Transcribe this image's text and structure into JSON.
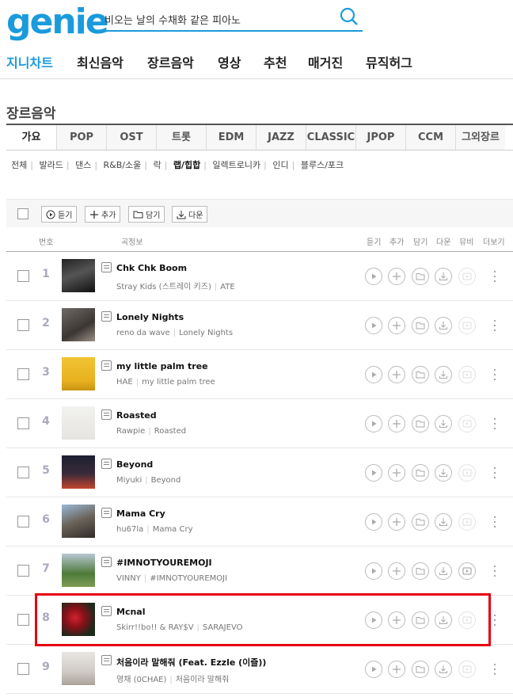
{
  "header": {
    "logo": "genie",
    "search_text": "비오는 날의 수채화 같은 피아노",
    "search_icon": "search-icon"
  },
  "nav": [
    "지니차트",
    "최신음악",
    "장르음악",
    "영상",
    "추천",
    "매거진",
    "뮤직허그"
  ],
  "section_title": "장르음악",
  "genre_tabs": [
    "가요",
    "POP",
    "OST",
    "트롯",
    "EDM",
    "JAZZ",
    "CLASSIC",
    "JPOP",
    "CCM",
    "그외장르"
  ],
  "subgenres": [
    "전체",
    "발라드",
    "댄스",
    "R&B/소울",
    "락",
    "랩/힙합",
    "일렉트로니카",
    "인디",
    "블루스/포크"
  ],
  "toolbar": {
    "listen": "듣기",
    "add": "추가",
    "save": "담기",
    "download": "다운"
  },
  "list_header": {
    "number": "번호",
    "song_info": "곡정보",
    "listen": "듣기",
    "add": "추가",
    "save": "담기",
    "download": "다운",
    "mv": "뮤비",
    "more": "더보기"
  },
  "songs": [
    {
      "rank": "1",
      "title": "Chk Chk Boom",
      "artist": "Stray Kids (스트레이 키즈)",
      "album": "ATE"
    },
    {
      "rank": "2",
      "title": "Lonely Nights",
      "artist": "reno da wave",
      "album": "Lonely Nights"
    },
    {
      "rank": "3",
      "title": "my little palm tree",
      "artist": "HAE",
      "album": "my little palm tree"
    },
    {
      "rank": "4",
      "title": "Roasted",
      "artist": "Rawpie",
      "album": "Roasted"
    },
    {
      "rank": "5",
      "title": "Beyond",
      "artist": "Miyuki",
      "album": "Beyond"
    },
    {
      "rank": "6",
      "title": "Mama Cry",
      "artist": "hu67la",
      "album": "Mama Cry"
    },
    {
      "rank": "7",
      "title": "#IMNOTYOUREMOJI",
      "artist": "VINNY",
      "album": "#IMNOTYOUREMOJI"
    },
    {
      "rank": "8",
      "title": "Mcnal",
      "artist": "Skirr!!bo!! & RAY$V",
      "album": "SARAJEVO"
    },
    {
      "rank": "9",
      "title": "처음이라 말해줘 (Feat. Ezzle (이즐))",
      "artist": "영채 (0CHAE)",
      "album": "처음이라 말해줘"
    }
  ],
  "colors": {
    "brand": "#1a9bdc",
    "highlight": "#e60012"
  }
}
